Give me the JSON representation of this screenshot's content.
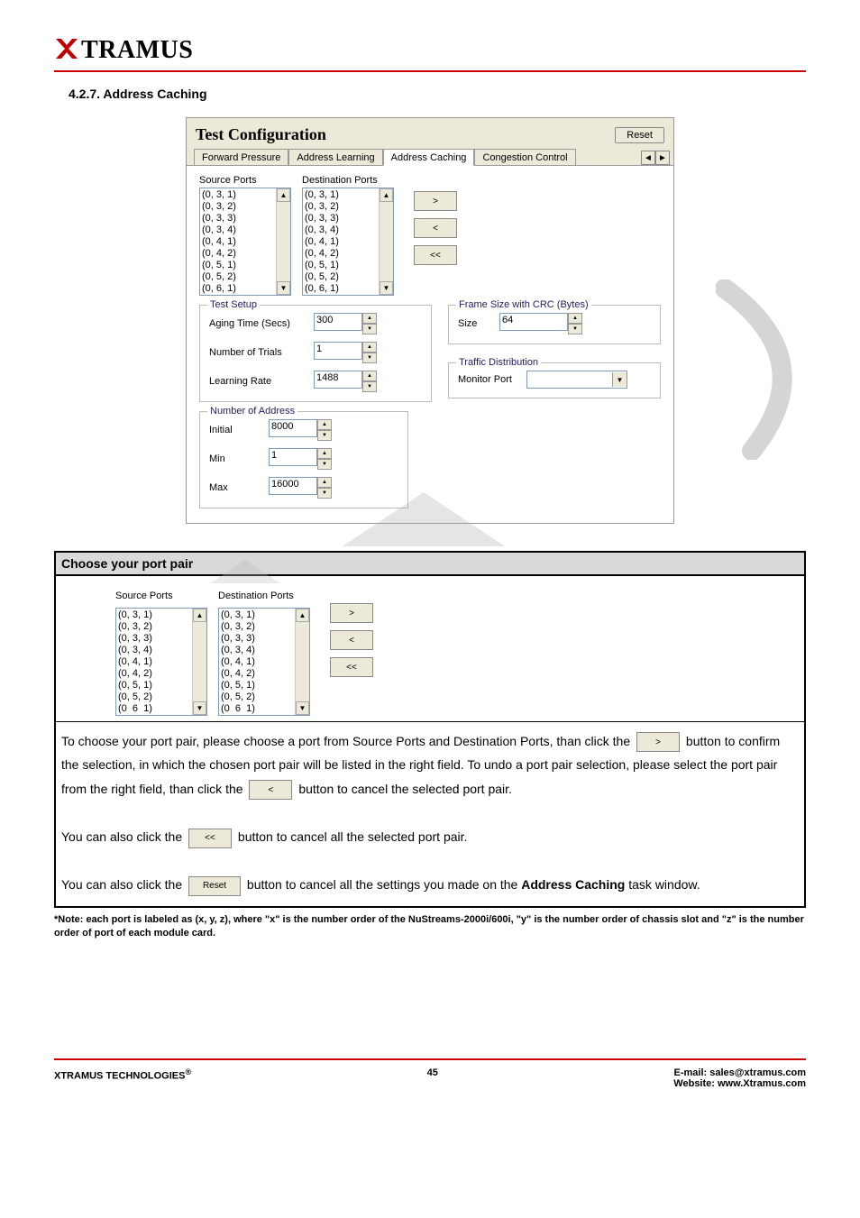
{
  "header": {
    "logo_text": "TRAMUS"
  },
  "section": {
    "number_title": "4.2.7. Address Caching"
  },
  "dialog": {
    "title": "Test Configuration",
    "reset_label": "Reset",
    "tabs": {
      "forward_pressure": "Forward Pressure",
      "address_learning": "Address Learning",
      "address_caching": "Address Caching",
      "congestion_control": "Congestion Control"
    },
    "ports": {
      "source_label": "Source Ports",
      "dest_label": "Destination Ports",
      "items": [
        "(0, 3, 1)",
        "(0, 3, 2)",
        "(0, 3, 3)",
        "(0, 3, 4)",
        "(0, 4, 1)",
        "(0, 4, 2)",
        "(0, 5, 1)",
        "(0, 5, 2)",
        "(0, 6, 1)"
      ],
      "btn_add": ">",
      "btn_remove": "<",
      "btn_clear": "<<"
    },
    "test_setup": {
      "title": "Test Setup",
      "aging_label": "Aging Time (Secs)",
      "aging_value": "300",
      "trials_label": "Number of Trials",
      "trials_value": "1",
      "learning_label": "Learning Rate",
      "learning_value": "1488"
    },
    "frame_size": {
      "title": "Frame Size with CRC (Bytes)",
      "size_label": "Size",
      "size_value": "64"
    },
    "traffic": {
      "title": "Traffic Distribution",
      "monitor_label": "Monitor Port"
    },
    "num_addr": {
      "title": "Number of Address",
      "initial_label": "Initial",
      "initial_value": "8000",
      "min_label": "Min",
      "min_value": "1",
      "max_label": "Max",
      "max_value": "16000"
    }
  },
  "table": {
    "header": "Choose your port pair",
    "body1a": "To choose your port pair, please choose a port from Source Ports and Destination Ports, than click the ",
    "body1b": " button to confirm the selection, in which the chosen port pair will be listed in the right field. To undo a port pair selection, please select the port pair from the right field, than click the ",
    "body1c": " button to cancel the selected port pair.",
    "body2a": "You can also click the ",
    "body2b": " button to cancel all the selected port pair.",
    "body3a": "You can also click the ",
    "body3b": " button to cancel all the settings you made on the ",
    "body3c": "Address Caching",
    "body3d": " task window."
  },
  "footnote": "*Note: each port is labeled as (x, y, z), where \"x\" is the number order of the NuStreams-2000i/600i, \"y\" is the number order of chassis slot and \"z\" is the number order of port of each module card.",
  "footer": {
    "left": "XTRAMUS TECHNOLOGIES",
    "center": "45",
    "email_label": "E-mail: sales@xtramus.com",
    "website": "Website:  www.Xtramus.com"
  },
  "ports2": {
    "items": [
      "(0, 3, 1)",
      "(0, 3, 2)",
      "(0, 3, 3)",
      "(0, 3, 4)",
      "(0, 4, 1)",
      "(0, 4, 2)",
      "(0, 5, 1)",
      "(0, 5, 2)",
      "(0  6  1)"
    ]
  }
}
